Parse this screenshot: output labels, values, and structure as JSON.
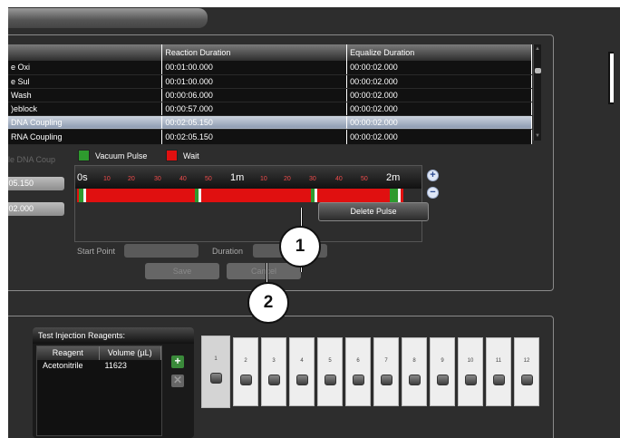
{
  "table": {
    "columns": [
      "",
      "Reaction Duration",
      "Equalize Duration"
    ],
    "rows": [
      {
        "name": "e Oxi",
        "reaction": "00:01:00.000",
        "equalize": "00:00:02.000",
        "selected": false
      },
      {
        "name": "e Sul",
        "reaction": "00:01:00.000",
        "equalize": "00:00:02.000",
        "selected": false
      },
      {
        "name": "Wash",
        "reaction": "00:00:06.000",
        "equalize": "00:00:02.000",
        "selected": false
      },
      {
        "name": ")eblock",
        "reaction": "00:00:57.000",
        "equalize": "00:00:02.000",
        "selected": false
      },
      {
        "name": "DNA Coupling",
        "reaction": "00:02:05.150",
        "equalize": "00:00:02.000",
        "selected": true
      },
      {
        "name": "RNA Coupling",
        "reaction": "00:02:05.150",
        "equalize": "00:00:02.000",
        "selected": false
      }
    ]
  },
  "editor": {
    "step_name": "le DNA Coup",
    "reaction_value": ":05.150",
    "equalize_value": ":02.000"
  },
  "legend": {
    "vacuum_label": "Vacuum Pulse",
    "vacuum_color": "#2e9a2e",
    "wait_label": "Wait",
    "wait_color": "#e01010"
  },
  "timeline": {
    "ticks": [
      "0s",
      "10",
      "20",
      "30",
      "40",
      "50",
      "1m",
      "10",
      "20",
      "30",
      "40",
      "50",
      "2m"
    ],
    "zoom_in_icon": "zoom-in-icon",
    "zoom_out_icon": "zoom-out-icon"
  },
  "context_menu": {
    "delete_pulse": "Delete Pulse"
  },
  "form": {
    "start_point_label": "Start Point",
    "duration_label": "Duration",
    "save_label": "Save",
    "cancel_label": "Cancel"
  },
  "callouts": {
    "one": "1",
    "two": "2"
  },
  "reagents": {
    "title": "Test Injection Reagents:",
    "col_reagent": "Reagent",
    "col_volume": "Volume (µL)",
    "rows": [
      {
        "reagent": "Acetonitrile",
        "volume": "11623"
      }
    ],
    "add_icon": "plus-icon",
    "remove_icon": "x-icon"
  },
  "wells": [
    "1",
    "2",
    "3",
    "4",
    "5",
    "6",
    "7",
    "8",
    "9",
    "10",
    "11",
    "12"
  ]
}
